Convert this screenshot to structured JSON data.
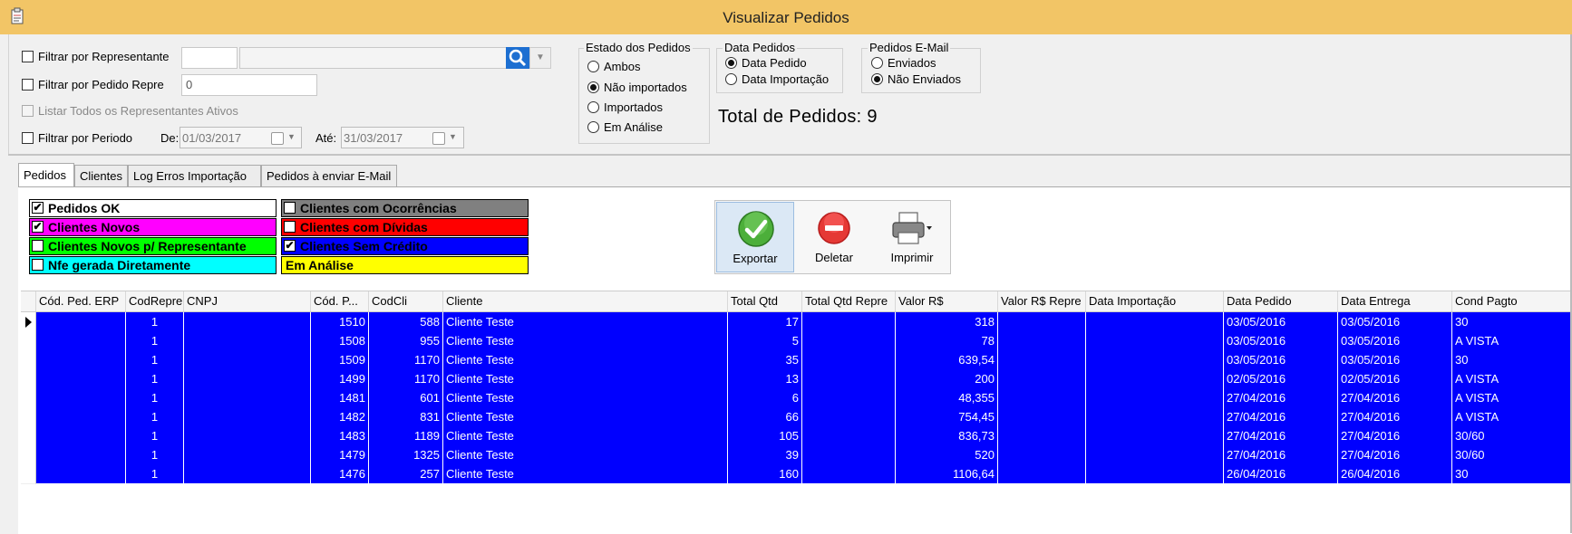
{
  "window": {
    "title": "Visualizar Pedidos"
  },
  "filters": {
    "representante_label": "Filtrar por Representante",
    "pedido_repre_label": "Filtrar por Pedido Repre",
    "pedido_repre_value": "0",
    "listar_todos_label": "Listar Todos os Representantes Ativos",
    "periodo_label": "Filtrar por Periodo",
    "de_label": "De:",
    "de_value": "01/03/2017",
    "ate_label": "Até:",
    "ate_value": "31/03/2017"
  },
  "estado": {
    "title": "Estado dos Pedidos",
    "options": [
      "Ambos",
      "Não importados",
      "Importados",
      "Em Análise"
    ],
    "selected": "Não importados"
  },
  "data_pedidos": {
    "title": "Data Pedidos",
    "options": [
      "Data Pedido",
      "Data Importação"
    ],
    "selected": "Data Pedido"
  },
  "pedidos_email": {
    "title": "Pedidos E-Mail",
    "options": [
      "Enviados",
      "Não Enviados"
    ],
    "selected": "Não Enviados"
  },
  "total": {
    "label": "Total de Pedidos:",
    "value": "9"
  },
  "tabs": [
    {
      "label": "Pedidos",
      "active": true
    },
    {
      "label": "Clientes",
      "active": false
    },
    {
      "label": "Log Erros Importação",
      "active": false
    },
    {
      "label": "Pedidos à enviar E-Mail",
      "active": false
    }
  ],
  "legend": [
    {
      "label": "Pedidos OK",
      "color": "#ffffff",
      "text_color": "#000000",
      "checked": true
    },
    {
      "label": "Clientes Novos",
      "color": "#ff00ff",
      "text_color": "#000000",
      "checked": true
    },
    {
      "label": "Clientes Novos p/ Representante",
      "color": "#00ff00",
      "text_color": "#000000",
      "checked": false
    },
    {
      "label": "Nfe gerada Diretamente",
      "color": "#00ffff",
      "text_color": "#000000",
      "checked": false
    },
    {
      "label": "Clientes com Ocorrências",
      "color": "#808080",
      "text_color": "#000000",
      "checked": false
    },
    {
      "label": "Clientes com Dívidas",
      "color": "#ff0000",
      "text_color": "#000000",
      "checked": false
    },
    {
      "label": "Clientes Sem Crédito",
      "color": "#0000ff",
      "text_color": "#000000",
      "checked": true
    },
    {
      "label": "Em Análise",
      "color": "#ffff00",
      "text_color": "#000000",
      "checked": null
    }
  ],
  "toolbar": {
    "exportar": "Exportar",
    "deletar": "Deletar",
    "imprimir": "Imprimir"
  },
  "grid": {
    "columns": [
      "Cód. Ped. ERP",
      "CodRepre",
      "CNPJ",
      "Cód. P...",
      "CodCli",
      "Cliente",
      "Total Qtd",
      "Total Qtd Repre",
      "Valor R$",
      "Valor R$ Repre",
      "Data Importação",
      "Data Pedido",
      "Data Entrega",
      "Cond Pagto"
    ],
    "rows": [
      [
        "",
        "1",
        "",
        "1510",
        "588",
        "Cliente Teste",
        "17",
        "",
        "318",
        "",
        "",
        "03/05/2016",
        "03/05/2016",
        "30"
      ],
      [
        "",
        "1",
        "",
        "1508",
        "955",
        "Cliente Teste",
        "5",
        "",
        "78",
        "",
        "",
        "03/05/2016",
        "03/05/2016",
        "A VISTA"
      ],
      [
        "",
        "1",
        "",
        "1509",
        "1170",
        "Cliente Teste",
        "35",
        "",
        "639,54",
        "",
        "",
        "03/05/2016",
        "03/05/2016",
        "30"
      ],
      [
        "",
        "1",
        "",
        "1499",
        "1170",
        "Cliente Teste",
        "13",
        "",
        "200",
        "",
        "",
        "02/05/2016",
        "02/05/2016",
        "A VISTA"
      ],
      [
        "",
        "1",
        "",
        "1481",
        "601",
        "Cliente Teste",
        "6",
        "",
        "48,355",
        "",
        "",
        "27/04/2016",
        "27/04/2016",
        "A VISTA"
      ],
      [
        "",
        "1",
        "",
        "1482",
        "831",
        "Cliente Teste",
        "66",
        "",
        "754,45",
        "",
        "",
        "27/04/2016",
        "27/04/2016",
        "A VISTA"
      ],
      [
        "",
        "1",
        "",
        "1483",
        "1189",
        "Cliente Teste",
        "105",
        "",
        "836,73",
        "",
        "",
        "27/04/2016",
        "27/04/2016",
        "30/60"
      ],
      [
        "",
        "1",
        "",
        "1479",
        "1325",
        "Cliente Teste",
        "39",
        "",
        "520",
        "",
        "",
        "27/04/2016",
        "27/04/2016",
        "30/60"
      ],
      [
        "",
        "1",
        "",
        "1476",
        "257",
        "Cliente Teste",
        "160",
        "",
        "1106,64",
        "",
        "",
        "26/04/2016",
        "26/04/2016",
        "30"
      ]
    ]
  },
  "colors": {
    "titlebar": "#f2c566",
    "row_bg": "#0000ff",
    "search_btn": "#1d6fd1"
  }
}
